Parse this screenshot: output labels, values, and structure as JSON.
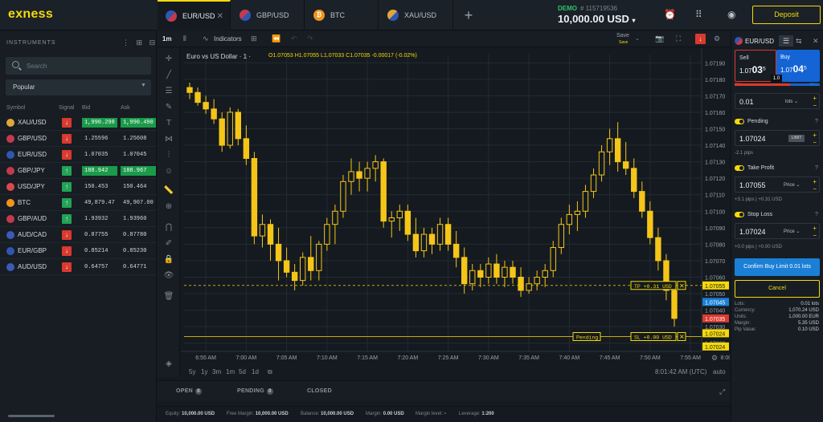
{
  "app": {
    "logo": "exness"
  },
  "tabs": [
    {
      "label": "EUR/USD",
      "icon": "eur-usd-flag-icon"
    },
    {
      "label": "GBP/USD",
      "icon": "gbp-usd-flag-icon"
    },
    {
      "label": "BTC",
      "icon": "bitcoin-icon"
    },
    {
      "label": "XAU/USD",
      "icon": "gold-usd-icon"
    }
  ],
  "account": {
    "mode": "DEMO",
    "id": "# 115719536",
    "balance": "10,000.00 USD",
    "deposit_label": "Deposit"
  },
  "instruments": {
    "title": "INSTRUMENTS",
    "search_placeholder": "Search",
    "filter": "Popular",
    "columns": [
      "Symbol",
      "Signal",
      "Bid",
      "Ask"
    ],
    "rows": [
      {
        "symbol": "XAU/USD",
        "signal": "down",
        "bid": "1,990.298",
        "ask": "1,990.490",
        "highlight": true,
        "color": "#e0a63a"
      },
      {
        "symbol": "GBP/USD",
        "signal": "down",
        "bid": "1.25596",
        "ask": "1.25608",
        "highlight": false,
        "color": "#c23b4c"
      },
      {
        "symbol": "EUR/USD",
        "signal": "down",
        "bid": "1.07035",
        "ask": "1.07045",
        "highlight": false,
        "color": "#2f56b3"
      },
      {
        "symbol": "GBP/JPY",
        "signal": "up",
        "bid": "188.942",
        "ask": "188.967",
        "highlight": true,
        "color": "#c23b4c"
      },
      {
        "symbol": "USD/JPY",
        "signal": "up",
        "bid": "150.453",
        "ask": "150.464",
        "highlight": false,
        "color": "#d84a4a"
      },
      {
        "symbol": "BTC",
        "signal": "up",
        "bid": "49,879.47",
        "ask": "49,907.00",
        "highlight": false,
        "color": "#f2931a"
      },
      {
        "symbol": "GBP/AUD",
        "signal": "up",
        "bid": "1.93932",
        "ask": "1.93960",
        "highlight": false,
        "color": "#c23b4c"
      },
      {
        "symbol": "AUD/CAD",
        "signal": "down",
        "bid": "0.87755",
        "ask": "0.87780",
        "highlight": false,
        "color": "#3a5bb7"
      },
      {
        "symbol": "EUR/GBP",
        "signal": "down",
        "bid": "0.85214",
        "ask": "0.85230",
        "highlight": false,
        "color": "#2f56b3"
      },
      {
        "symbol": "AUD/USD",
        "signal": "down",
        "bid": "0.64757",
        "ask": "0.64771",
        "highlight": false,
        "color": "#3a5bb7"
      }
    ]
  },
  "chart_toolbar": {
    "timeframe": "1m",
    "indicators_label": "Indicators",
    "save_label": "Save",
    "save_sub": "Save"
  },
  "chart_header": {
    "title": "Euro vs US Dollar · 1 ·",
    "ohlc": "O1.07053 H1.07055 L1.07033 C1.07035 -0.00017 (-0.02%)"
  },
  "chart_data": {
    "type": "candlestick",
    "title": "Euro vs US Dollar · 1",
    "y_ticks": [
      "1.07190",
      "1.07180",
      "1.07170",
      "1.07160",
      "1.07150",
      "1.07140",
      "1.07130",
      "1.07120",
      "1.07110",
      "1.07100",
      "1.07090",
      "1.07080",
      "1.07070",
      "1.07060",
      "1.07050",
      "1.07040",
      "1.07030",
      "1.07020"
    ],
    "ylim": [
      1.07015,
      1.07195
    ],
    "x_ticks": [
      "6:55 AM",
      "7:00 AM",
      "7:05 AM",
      "7:10 AM",
      "7:15 AM",
      "7:20 AM",
      "7:25 AM",
      "7:30 AM",
      "7:35 AM",
      "7:40 AM",
      "7:45 AM",
      "7:50 AM",
      "7:55 AM",
      "8:00 AM"
    ],
    "start_time": "6:53 AM",
    "interval_minutes": 1,
    "candles": [
      [
        1.07175,
        1.07178,
        1.07168,
        1.07172
      ],
      [
        1.07172,
        1.07175,
        1.07164,
        1.07166
      ],
      [
        1.07166,
        1.0717,
        1.07159,
        1.07162
      ],
      [
        1.07162,
        1.07168,
        1.07153,
        1.07156
      ],
      [
        1.07156,
        1.0716,
        1.07136,
        1.0714
      ],
      [
        1.0714,
        1.07163,
        1.07138,
        1.0716
      ],
      [
        1.0716,
        1.07162,
        1.0714,
        1.07144
      ],
      [
        1.07144,
        1.07152,
        1.07128,
        1.07132
      ],
      [
        1.07132,
        1.07136,
        1.0708,
        1.07085
      ],
      [
        1.07085,
        1.07098,
        1.07078,
        1.07092
      ],
      [
        1.07092,
        1.07095,
        1.0707,
        1.0708
      ],
      [
        1.0708,
        1.0709,
        1.07058,
        1.0707
      ],
      [
        1.0707,
        1.07078,
        1.0706,
        1.07063
      ],
      [
        1.07063,
        1.07068,
        1.07052,
        1.07058
      ],
      [
        1.07058,
        1.07075,
        1.07055,
        1.07072
      ],
      [
        1.07072,
        1.07085,
        1.07058,
        1.07064
      ],
      [
        1.07064,
        1.07082,
        1.07058,
        1.0708
      ],
      [
        1.0708,
        1.07096,
        1.07076,
        1.07092
      ],
      [
        1.07092,
        1.07104,
        1.0708,
        1.071
      ],
      [
        1.071,
        1.07122,
        1.07096,
        1.07118
      ],
      [
        1.07118,
        1.07132,
        1.0711,
        1.07124
      ],
      [
        1.07124,
        1.0713,
        1.07112,
        1.0712
      ],
      [
        1.0712,
        1.0713,
        1.07112,
        1.07126
      ],
      [
        1.07126,
        1.07134,
        1.07118,
        1.0713
      ],
      [
        1.0713,
        1.07132,
        1.0709,
        1.07094
      ],
      [
        1.07094,
        1.071,
        1.07084,
        1.07096
      ],
      [
        1.07096,
        1.07104,
        1.07088,
        1.071
      ],
      [
        1.071,
        1.07104,
        1.07082,
        1.07086
      ],
      [
        1.07086,
        1.07096,
        1.07072,
        1.07076
      ],
      [
        1.07076,
        1.0709,
        1.07072,
        1.07086
      ],
      [
        1.07086,
        1.0709,
        1.07074,
        1.0708
      ],
      [
        1.0708,
        1.07096,
        1.07076,
        1.07092
      ],
      [
        1.07092,
        1.07096,
        1.07076,
        1.0708
      ],
      [
        1.0708,
        1.07088,
        1.07066,
        1.07072
      ],
      [
        1.07072,
        1.07078,
        1.0705,
        1.07056
      ],
      [
        1.07056,
        1.07068,
        1.07052,
        1.07064
      ],
      [
        1.07064,
        1.07068,
        1.07054,
        1.0706
      ],
      [
        1.0706,
        1.07072,
        1.07056,
        1.07068
      ],
      [
        1.07068,
        1.07074,
        1.07056,
        1.0706
      ],
      [
        1.0706,
        1.0707,
        1.07054,
        1.07066
      ],
      [
        1.07066,
        1.0707,
        1.07056,
        1.0706
      ],
      [
        1.0706,
        1.07066,
        1.07048,
        1.07052
      ],
      [
        1.07052,
        1.0706,
        1.0705,
        1.07056
      ],
      [
        1.07056,
        1.07064,
        1.07052,
        1.0706
      ],
      [
        1.0706,
        1.07068,
        1.07054,
        1.07064
      ],
      [
        1.07064,
        1.07082,
        1.0706,
        1.07078
      ],
      [
        1.07078,
        1.07096,
        1.07074,
        1.07092
      ],
      [
        1.07092,
        1.07104,
        1.07086,
        1.07098
      ],
      [
        1.07098,
        1.07106,
        1.07088,
        1.071
      ],
      [
        1.071,
        1.07116,
        1.07096,
        1.07112
      ],
      [
        1.07112,
        1.07126,
        1.07108,
        1.07122
      ],
      [
        1.07122,
        1.0714,
        1.07118,
        1.07136
      ],
      [
        1.07136,
        1.0715,
        1.07128,
        1.07144
      ],
      [
        1.07144,
        1.07154,
        1.07124,
        1.0713
      ],
      [
        1.0713,
        1.07142,
        1.07122,
        1.07126
      ],
      [
        1.07126,
        1.07132,
        1.07108,
        1.07112
      ],
      [
        1.07112,
        1.07118,
        1.07096,
        1.071
      ],
      [
        1.071,
        1.07106,
        1.0708,
        1.07084
      ],
      [
        1.07084,
        1.0709,
        1.07064,
        1.0707
      ],
      [
        1.0707,
        1.07074,
        1.07046,
        1.07052
      ],
      [
        1.07052,
        1.07056,
        1.0703,
        1.07035
      ]
    ],
    "price_lines": [
      {
        "price": 1.07055,
        "style": "dashed"
      },
      {
        "price": 1.07024,
        "style": "solid"
      }
    ],
    "order_labels": [
      {
        "text": "TP +0.31 USD",
        "price": 1.07055
      },
      {
        "text": "SL +0.00 USD",
        "price": 1.07024
      },
      {
        "text": "Pending",
        "price": 1.07024
      }
    ],
    "price_badges": [
      {
        "text": "1.07055",
        "price": 1.07055,
        "color": "#f5d90a"
      },
      {
        "text": "1.07045",
        "price": 1.07045,
        "color": "#1b7fd6"
      },
      {
        "text": "1.07035",
        "price": 1.07035,
        "color": "#d93a2f"
      },
      {
        "text": "1.07024",
        "price": 1.07026,
        "color": "#f5d90a"
      },
      {
        "text": "1.07024",
        "price": 1.07018,
        "color": "#f5d90a"
      }
    ],
    "candle_color": "#f5c518"
  },
  "range_bar": {
    "ranges": [
      "5y",
      "1y",
      "3m",
      "1m",
      "5d",
      "1d"
    ],
    "clock": "8:01:42 AM (UTC)",
    "auto": "auto"
  },
  "positions": {
    "tabs": [
      {
        "label": "OPEN",
        "count": "0"
      },
      {
        "label": "PENDING",
        "count": "0"
      },
      {
        "label": "CLOSED"
      }
    ]
  },
  "footer": [
    {
      "k": "Equity:",
      "v": "10,000.00 USD"
    },
    {
      "k": "Free Margin:",
      "v": "10,000.00 USD"
    },
    {
      "k": "Balance:",
      "v": "10,000.00 USD"
    },
    {
      "k": "Margin:",
      "v": "0.00 USD"
    },
    {
      "k": "Margin level:",
      "v": "-"
    },
    {
      "k": "Leverage:",
      "v": "1:200"
    }
  ],
  "order": {
    "symbol": "EUR/USD",
    "sell_label": "Sell",
    "sell_price_prefix": "1.07",
    "sell_price_big": "03",
    "sell_price_sup": "5",
    "buy_label": "Buy",
    "buy_price_prefix": "1.07",
    "buy_price_big": "04",
    "buy_price_sup": "5",
    "spread": "1.0",
    "sell_pct": "65%",
    "buy_pct": "35%",
    "sell_ratio": 0.65,
    "volume": "0.01",
    "volume_unit": "lots",
    "pending_label": "Pending",
    "pending_price": "1.07024",
    "pending_type": "LIMIT",
    "pending_sub": "-2.1 pips",
    "tp_label": "Take Profit",
    "tp_price": "1.07055",
    "tp_unit": "Price",
    "tp_sub": "+3.1 pips  |  +0.31 USD",
    "sl_label": "Stop Loss",
    "sl_price": "1.07024",
    "sl_unit": "Price",
    "sl_sub": "+0.0 pips  |  +0.00 USD",
    "confirm_label": "Confirm Buy Limit 0.01 lots",
    "cancel_label": "Cancel",
    "summary": [
      {
        "k": "Lots:",
        "v": "0.01 lots"
      },
      {
        "k": "Currency:",
        "v": "1,070.24 USD"
      },
      {
        "k": "Units:",
        "v": "1,000.00 EUR"
      },
      {
        "k": "Margin:",
        "v": "5.35 USD"
      },
      {
        "k": "Pip Value:",
        "v": "0.10 USD"
      }
    ]
  }
}
